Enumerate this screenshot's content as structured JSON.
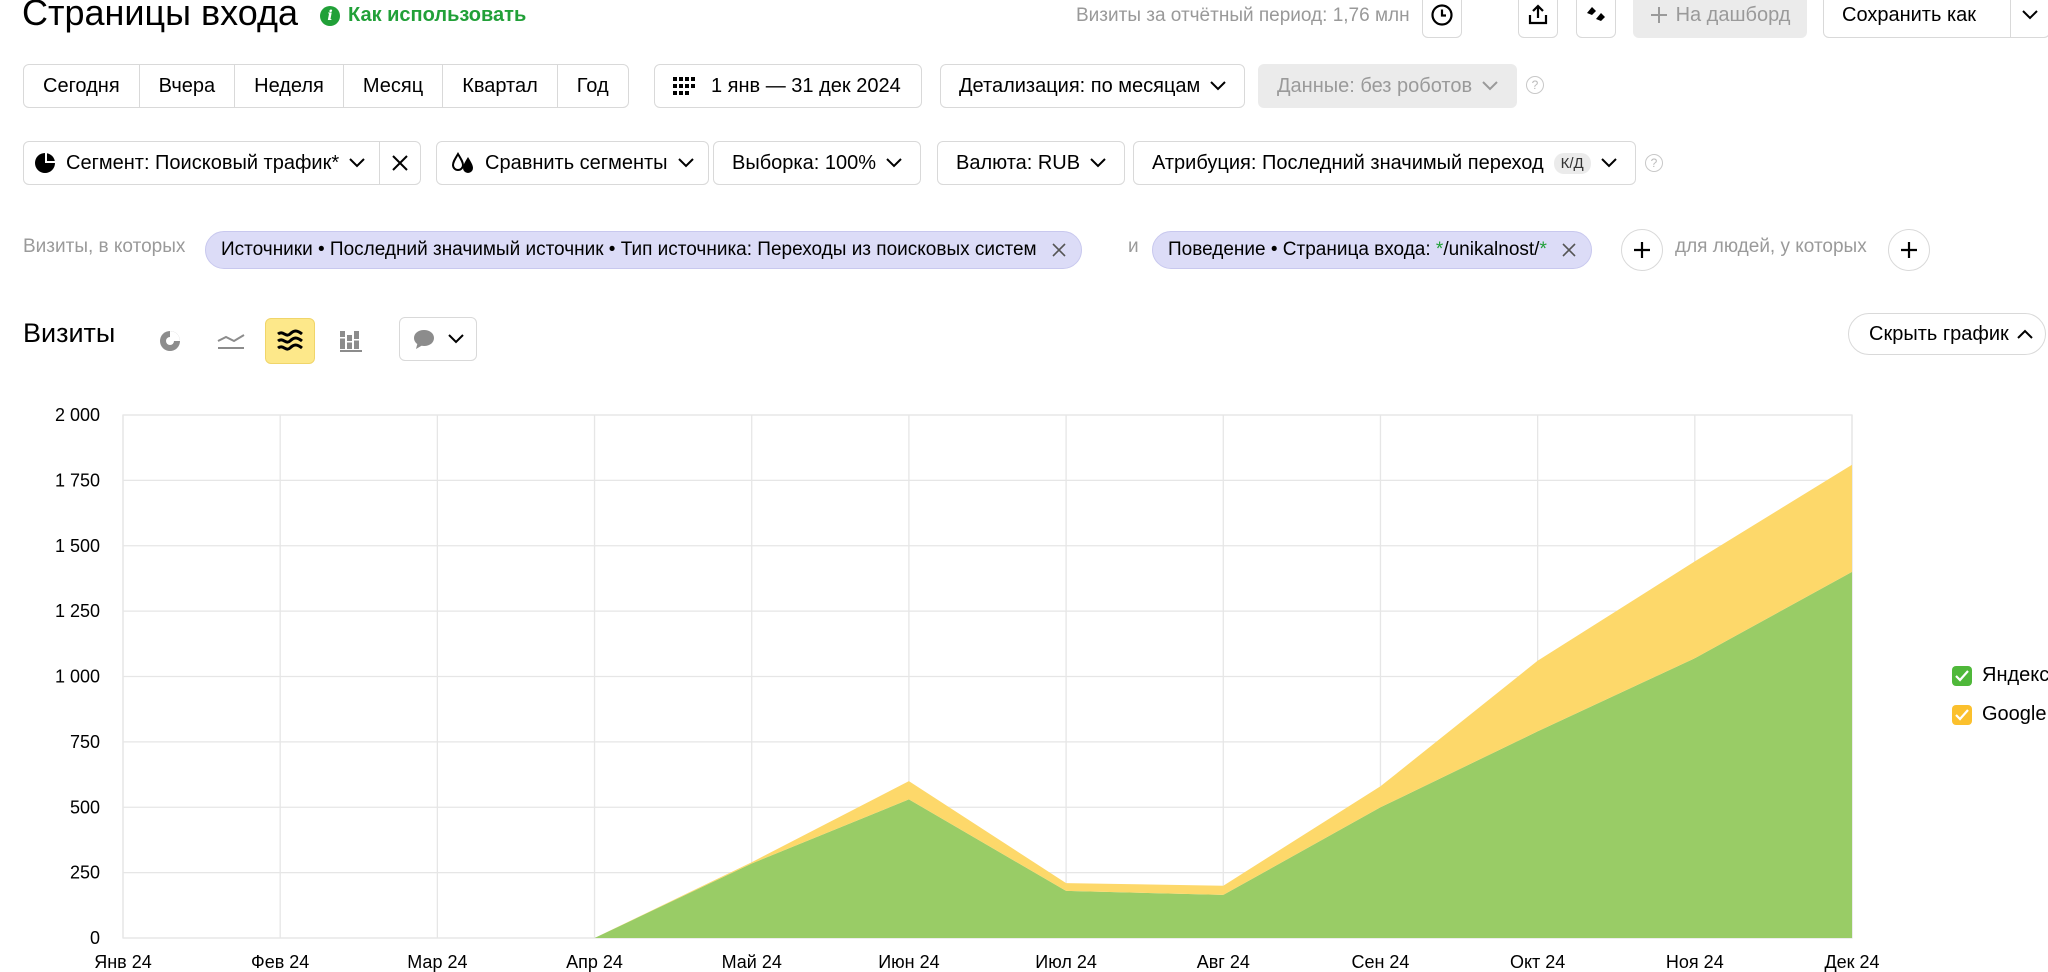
{
  "header": {
    "title": "Страницы входа",
    "howto_label": "Как использовать",
    "visits_period": "Визиты за отчётный период: 1,76 млн",
    "dashboard_label": "На дашборд",
    "save_label": "Сохранить как"
  },
  "periods": [
    "Сегодня",
    "Вчера",
    "Неделя",
    "Месяц",
    "Квартал",
    "Год"
  ],
  "date_range": "1 янв — 31 дек 2024",
  "detail": "Детализация: по месяцам",
  "data_filter": "Данные: без роботов",
  "segment": "Сегмент: Поисковый трафик*",
  "compare": "Сравнить сегменты",
  "sample": "Выборка: 100%",
  "currency": "Валюта: RUB",
  "attribution": "Атрибуция: Последний значимый переход",
  "attribution_badge": "К/Д",
  "filters": {
    "prefix": "Визиты, в которых",
    "chip1": "Источники • Последний значимый источник • Тип источника: Переходы из поисковых систем",
    "and": "и",
    "chip2_text": "Поведение • Страница входа: ",
    "chip2_star1": "*",
    "chip2_path": "/unikalnost/",
    "chip2_star2": "*",
    "people": "для людей, у которых"
  },
  "chart_header": {
    "title": "Визиты",
    "hide_label": "Скрыть график"
  },
  "colors": {
    "yandex": "#99cc66",
    "google": "#fdd86a",
    "chip": "#dcdcf7",
    "accent_green": "#21a038"
  },
  "chart_data": {
    "type": "area",
    "stacked": true,
    "categories": [
      "Янв 24",
      "Фев 24",
      "Мар 24",
      "Апр 24",
      "Май 24",
      "Июн 24",
      "Июл 24",
      "Авг 24",
      "Сен 24",
      "Окт 24",
      "Ноя 24",
      "Дек 24"
    ],
    "y_ticks": [
      "0",
      "250",
      "500",
      "750",
      "1 000",
      "1 250",
      "1 500",
      "1 750",
      "2 000"
    ],
    "ylim": [
      0,
      2000
    ],
    "grid": true,
    "legend_position": "right",
    "series": [
      {
        "name": "Яндекс",
        "values": [
          0,
          0,
          0,
          0,
          285,
          530,
          180,
          165,
          500,
          790,
          1070,
          1400
        ]
      },
      {
        "name": "Google",
        "values": [
          0,
          0,
          0,
          0,
          5,
          70,
          30,
          35,
          80,
          270,
          370,
          410
        ]
      }
    ]
  }
}
